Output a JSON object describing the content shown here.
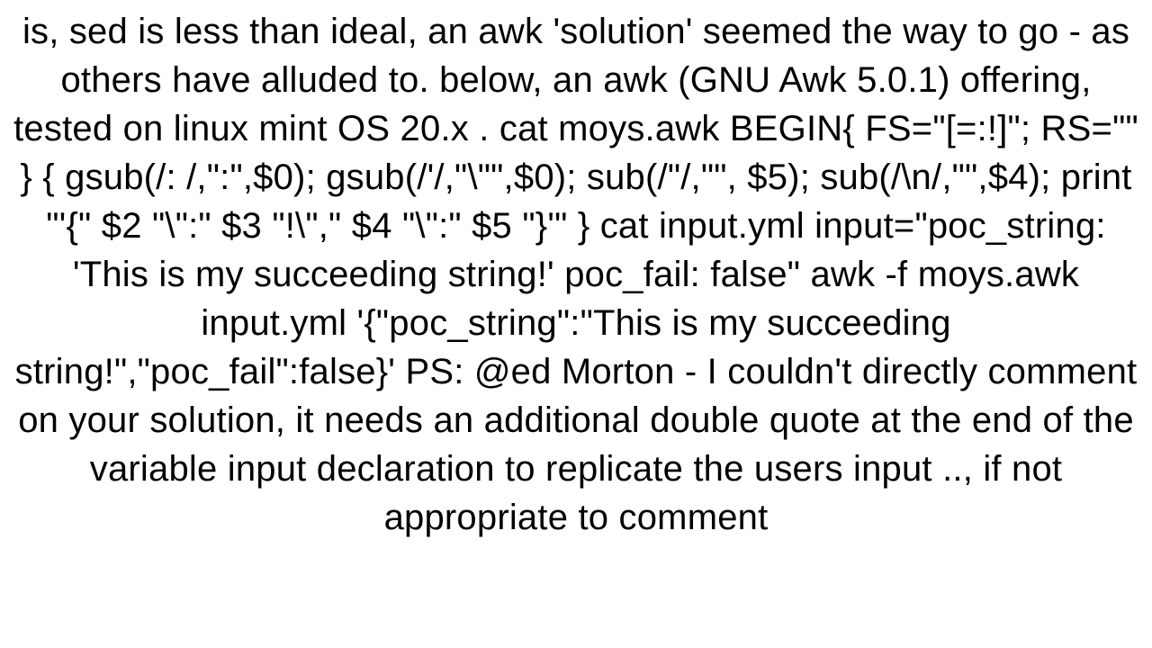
{
  "body": {
    "text": "is, sed is less than ideal, an awk 'solution' seemed the way to go - as others have alluded to. below, an awk (GNU Awk 5.0.1) offering, tested on linux mint OS 20.x . cat moys.awk  BEGIN{ FS=\"[=:!]\"; RS=\"\" }  {     gsub(/: /,\":\",$0);     gsub(/'/,\"\\\"\",$0);     sub(/\"/,\"\", $5); sub(/\\n/,\"\",$4);     print \"'{\" $2 \"\\\":\" $3 \"!\\\",\" $4 \"\\\":\" $5 \"}'\" }  cat input.yml  input=\"poc_string: 'This is my succeeding string!' poc_fail: false\"  awk -f moys.awk input.yml  '{\"poc_string\":\"This is my succeeding string!\",\"poc_fail\":false}'  PS: @ed Morton - I couldn't directly comment on your solution, it needs an additional double quote at the end of the variable input declaration to replicate the users input .., if not appropriate to comment"
  }
}
